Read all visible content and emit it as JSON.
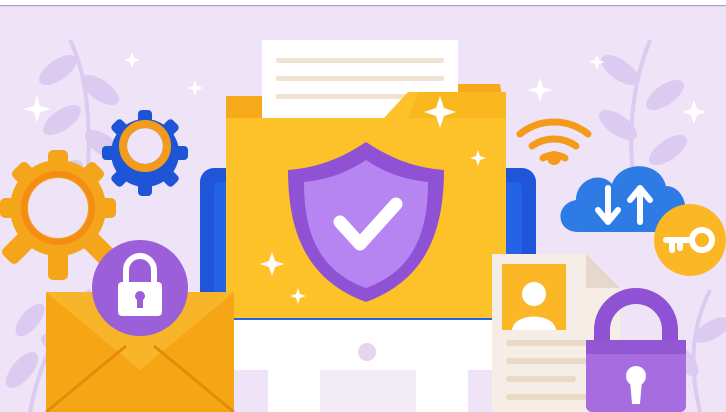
{
  "scene": {
    "colors": {
      "background": "#efe3f8",
      "leaf": "#dccaf0",
      "folder_back": "#f6a91a",
      "folder_front": "#fdc229",
      "shield": "#8f52d4",
      "shield_inner": "#b785f2",
      "monitor": "#1f55d8",
      "gear_blue": "#1e55d6",
      "gear_orange": "#f4a51a",
      "cloud": "#2f7be6",
      "key_badge": "#fbb725",
      "envelope": "#f6a514",
      "lock_purple": "#9a5fd9",
      "wifi": "#f49b1b"
    },
    "icons": [
      "gear-icon",
      "folder-icon",
      "shield-check-icon",
      "monitor-icon",
      "wifi-icon",
      "cloud-sync-icon",
      "key-icon",
      "envelope-icon",
      "padlock-icon",
      "document-icon",
      "user-card-icon",
      "sparkle-icon"
    ]
  }
}
